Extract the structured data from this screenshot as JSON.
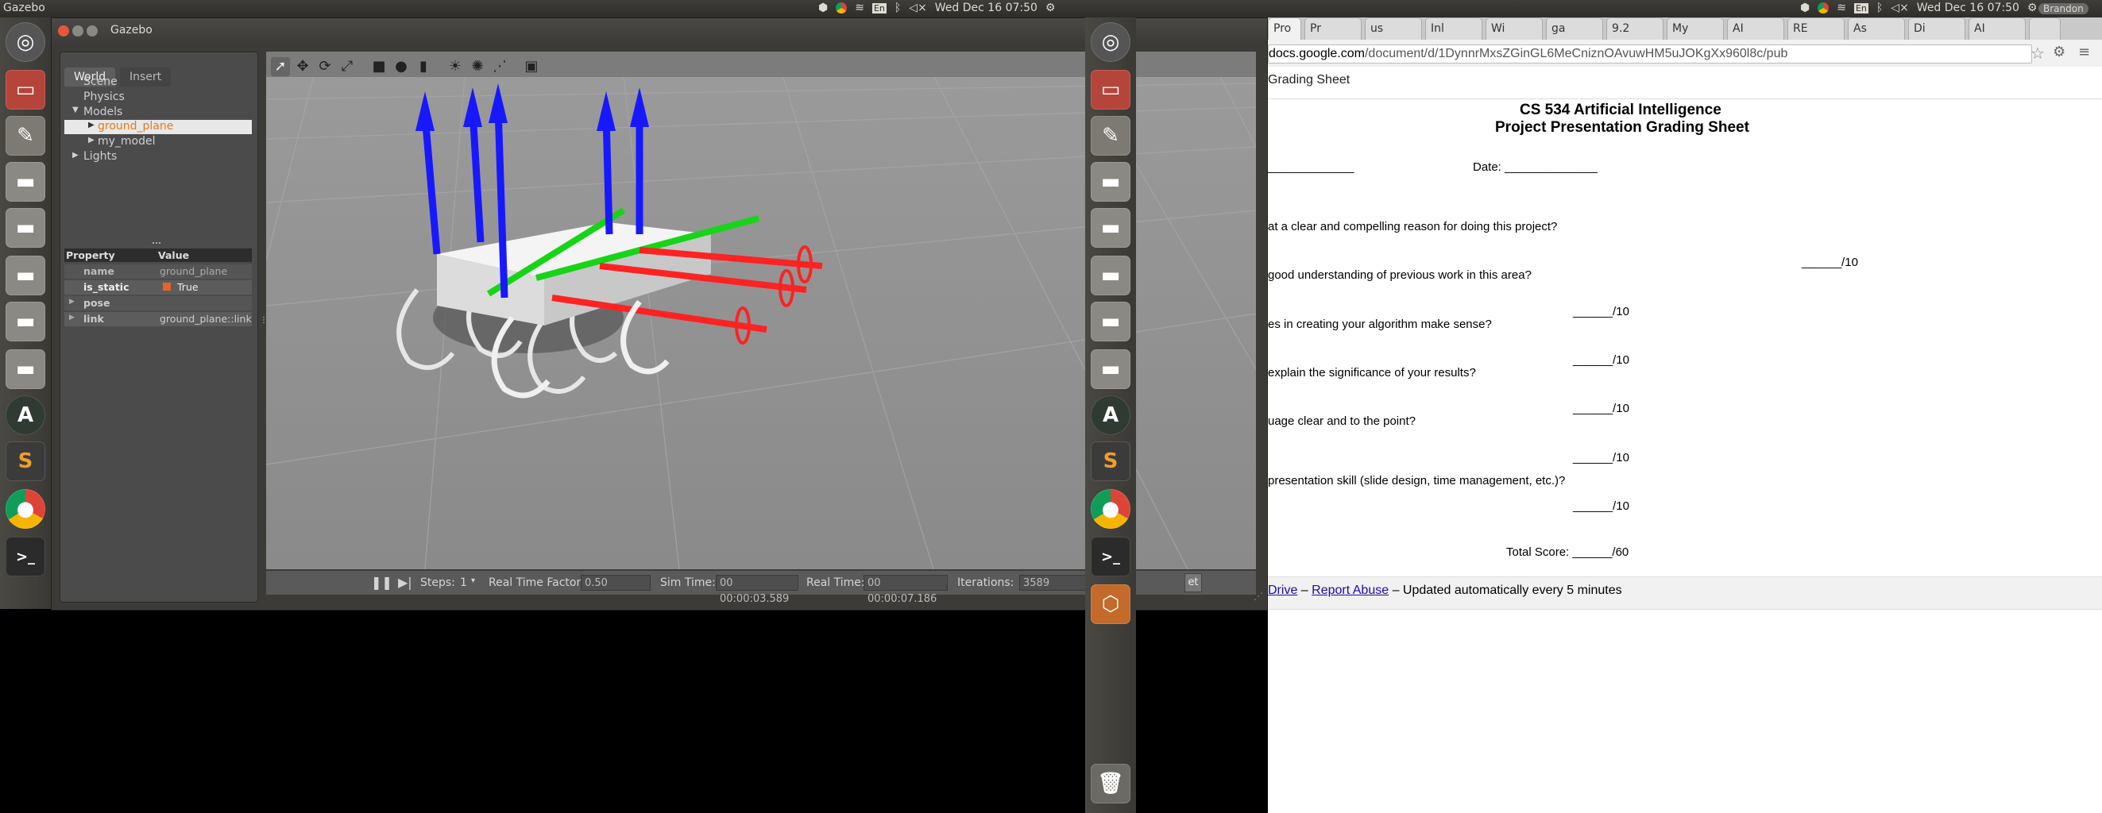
{
  "topbar_left": {
    "title": "Gazebo",
    "datetime": "Wed Dec 16 07:50",
    "lang": "En"
  },
  "topbar_right": {
    "datetime": "Wed Dec 16 07:50",
    "lang": "En",
    "user": "Brandon"
  },
  "gazebo": {
    "window_title": "Gazebo",
    "tabs": [
      "World",
      "Insert"
    ],
    "tree": {
      "scene": "Scene",
      "physics": "Physics",
      "models": "Models",
      "ground_plane": "ground_plane",
      "my_model": "my_model",
      "lights": "Lights"
    },
    "props": {
      "header_property": "Property",
      "header_value": "Value",
      "rows": [
        {
          "name": "name",
          "value": "ground_plane"
        },
        {
          "name": "is_static",
          "value": "True"
        },
        {
          "name": "pose",
          "value": ""
        },
        {
          "name": "link",
          "value": "ground_plane::link"
        }
      ]
    },
    "bottom": {
      "steps_label": "Steps:",
      "steps_value": "1",
      "rtf_label": "Real Time Factor:",
      "rtf_value": "0.50",
      "sim_label": "Sim Time:",
      "sim_value": "00 00:00:03.589",
      "real_label": "Real Time:",
      "real_value": "00 00:00:07.186",
      "iter_label": "Iterations:",
      "iter_value": "3589",
      "reset_tail": "et"
    }
  },
  "browser": {
    "tabs": [
      "Pro",
      "Pr",
      "us",
      "Inl",
      "Wi",
      "ga",
      "9.2",
      "My",
      "AI",
      "RE",
      "As",
      "Di",
      "AI"
    ],
    "url_prefix": "docs.google.com",
    "url_rest": "/document/d/1DynnrMxsZGinGL6MeCniznOAvuwHM5uJOKgXx960l8c/pub",
    "doc_header": "Grading Sheet",
    "title_line1": "CS 534 Artificial Intelligence",
    "title_line2": "Project Presentation Grading Sheet",
    "name_blank": "_____________",
    "date_label": "Date: ______________",
    "questions": [
      "at a clear and compelling reason for doing this project?",
      "good understanding of previous work in this area?",
      "es in creating your algorithm make sense?",
      "explain the significance of your results?",
      "uage clear and to the point?",
      "presentation skill (slide design, time management, etc.)?"
    ],
    "scores": [
      "______/10",
      "______/10",
      "______/10",
      "______/10",
      "______/10",
      "______/10"
    ],
    "total": "Total Score: ______/60",
    "footer_drive": "Drive",
    "footer_sep1": "–",
    "footer_report": "Report Abuse",
    "footer_sep2": "–",
    "footer_updated": "Updated automatically every 5 minutes"
  }
}
